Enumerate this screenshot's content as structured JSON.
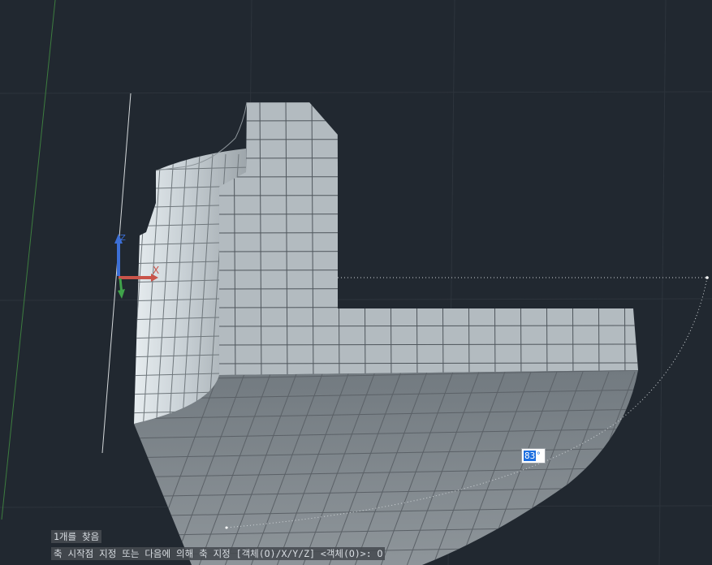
{
  "viewport": {
    "background": "#212830"
  },
  "ucs": {
    "z_label": "Z",
    "x_label": "X",
    "z_color": "#3c6fd6",
    "x_color": "#c9544a",
    "y_color": "#3fa34a"
  },
  "angle_input": {
    "value": "83",
    "unit": "°"
  },
  "command": {
    "history_line": "1개를 찾음",
    "prompt_line": "축 시작점 지정 또는 다음에 의해 축 지정 [객체(O)/X/Y/Z] <객체(O)>: O"
  }
}
